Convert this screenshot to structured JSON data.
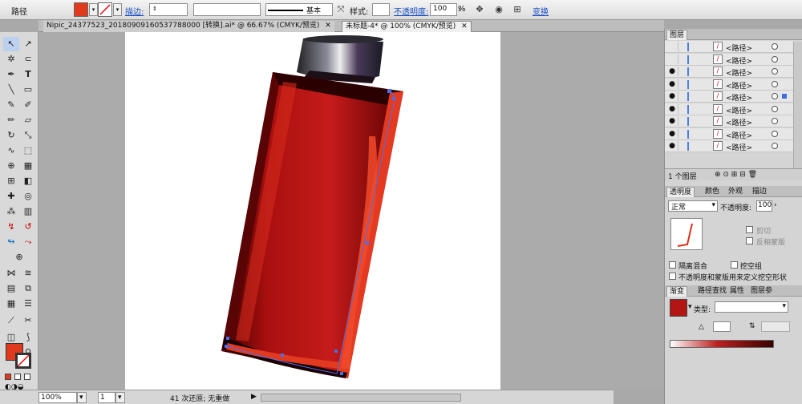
{
  "control_bar": {
    "object_type": "路径",
    "stroke_label": "描边:",
    "brush_name": "基本",
    "style_label": "样式:",
    "opacity_label": "不透明度:",
    "opacity_value": "100",
    "opacity_unit": "%",
    "transform_label": "变换",
    "fill_color": "#e03a1e"
  },
  "tabs": [
    {
      "label": "Nipic_24377523_20180909160537788000 [转换].ai* @ 66.67% (CMYK/预览)",
      "active": false
    },
    {
      "label": "未标题-4* @ 100% (CMYK/预览)",
      "active": true
    }
  ],
  "layers_panel": {
    "title": "图层",
    "rows": [
      {
        "name": "<路径>",
        "visible": false
      },
      {
        "name": "<路径>",
        "visible": false
      },
      {
        "name": "<路径>",
        "visible": true
      },
      {
        "name": "<路径>",
        "visible": true
      },
      {
        "name": "<路径>",
        "visible": true,
        "selected": true
      },
      {
        "name": "<路径>",
        "visible": true
      },
      {
        "name": "<路径>",
        "visible": true
      },
      {
        "name": "<路径>",
        "visible": true
      },
      {
        "name": "<路径>",
        "visible": true
      }
    ],
    "footer_label": "1 个图层"
  },
  "transparency_panel": {
    "tabs": [
      "透明度",
      "颜色",
      "外观",
      "描边"
    ],
    "blend_mode": "正常",
    "opacity_label": "不透明度:",
    "opacity_value": "100",
    "clip_label": "剪切",
    "invert_label": "反相蒙版",
    "isolate_label": "隔离混合",
    "knockout_label": "挖空组",
    "opacity_mask_label": "不透明度和蒙版用来定义挖空形状"
  },
  "gradient_panel": {
    "tabs": [
      "渐变",
      "路径查找",
      "属性",
      "图层参"
    ],
    "type_label": "类型:",
    "swatch_color": "#b31414"
  },
  "status_bar": {
    "zoom": "100%",
    "artboard": "1",
    "undo_info": "41 次还原; 无重做"
  }
}
